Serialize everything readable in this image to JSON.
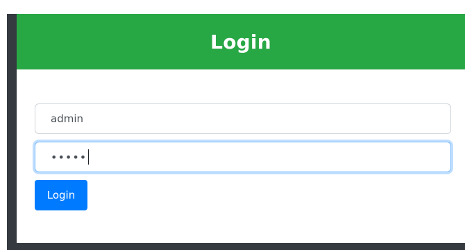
{
  "login_card": {
    "title": "Login",
    "username_field": {
      "value": "admin"
    },
    "password_field": {
      "value": "•••••"
    },
    "submit_label": "Login"
  },
  "colors": {
    "header": "#28a745",
    "button": "#007bff",
    "background": "#343a40"
  }
}
